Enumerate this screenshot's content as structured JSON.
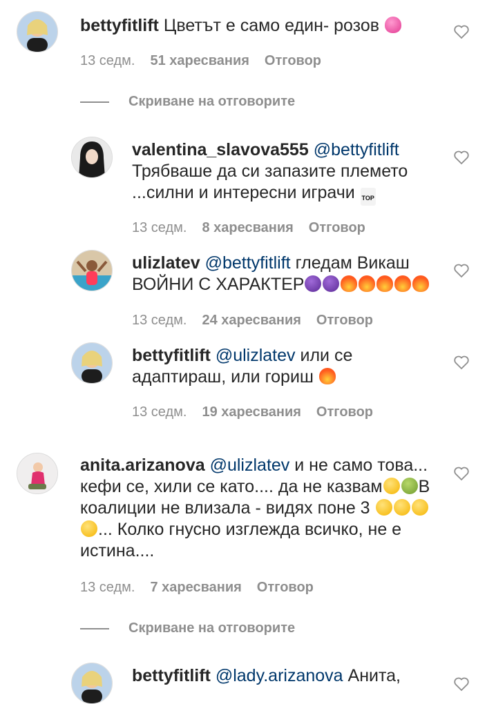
{
  "labels": {
    "hide_replies": "Скриване на отговорите",
    "reply": "Отговор"
  },
  "colors": {
    "text": "#262626",
    "meta": "#8e8e8e",
    "mention": "#00376b"
  },
  "comments": [
    {
      "user": "bettyfitlift",
      "text": "Цветът е само един- розов",
      "emoji": [
        "sparkling-heart"
      ],
      "time": "13 седм.",
      "likes": "51 харесвания",
      "reply": "Отговор"
    },
    {
      "user": "valentina_slavova555",
      "mention": "@bettyfitlift",
      "line1": "Трябваше да си запазите племето",
      "line2": "...силни и интересни играчи",
      "emoji": [
        "top-arrow"
      ],
      "emoji_text": "TOP",
      "time": "13 седм.",
      "likes": "8 харесвания",
      "reply": "Отговор"
    },
    {
      "user": "ulizlatev",
      "mention": "@bettyfitlift",
      "line1": "гледам Викаш",
      "line2": "ВОЙНИ С ХАРАКТЕР",
      "emoji": [
        "devil",
        "devil",
        "fire",
        "fire",
        "fire",
        "fire",
        "fire"
      ],
      "time": "13 седм.",
      "likes": "24 харесвания",
      "reply": "Отговор"
    },
    {
      "user": "bettyfitlift",
      "mention": "@ulizlatev",
      "line1": "или се",
      "line2": "адаптираш, или гориш",
      "emoji": [
        "fire"
      ],
      "time": "13 седм.",
      "likes": "19 харесвания",
      "reply": "Отговор"
    },
    {
      "user": "anita.arizanova",
      "mention": "@ulizlatev",
      "line1": "и не само това...",
      "line2": "кефи се, хили се като.... да не казвам",
      "line2b": "В",
      "line3": "коалиции не влизала - видях поне 3",
      "line4": "... Колко гнусно изглежда всичко, не е",
      "line5": "истина....",
      "emoji": [
        "confused",
        "nauseated",
        "confused",
        "confused",
        "confused",
        "confused"
      ],
      "time": "13 седм.",
      "likes": "7 харесвания",
      "reply": "Отговор"
    },
    {
      "user": "bettyfitlift",
      "mention": "@lady.arizanova",
      "line1": "Анита,"
    }
  ]
}
